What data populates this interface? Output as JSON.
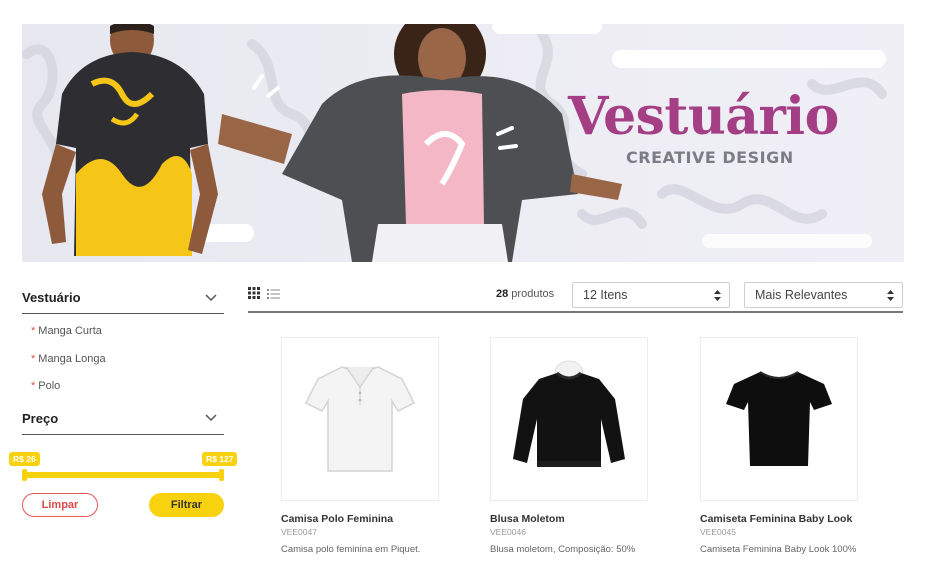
{
  "banner": {
    "title": "Vestuário",
    "subtitle": "CREATIVE DESIGN",
    "accent_color": "#a43f86"
  },
  "sidebar": {
    "category_filter": {
      "title": "Vestuário",
      "items": [
        {
          "label": "Manga Curta"
        },
        {
          "label": "Manga Longa"
        },
        {
          "label": "Polo"
        }
      ]
    },
    "price_filter": {
      "title": "Preço",
      "min_label": "R$ 26",
      "max_label": "R$ 127",
      "clear_label": "Limpar",
      "apply_label": "Filtrar"
    }
  },
  "toolbar": {
    "count_number": "28",
    "count_suffix": " produtos",
    "per_page_value": "12 Itens",
    "sort_value": "Mais Relevantes",
    "view_grid_icon": "grid-view-icon",
    "view_list_icon": "list-view-icon"
  },
  "products": [
    {
      "name": "Camisa Polo Feminina",
      "sku": "VEE0047",
      "desc": "Camisa polo feminina em Piquet."
    },
    {
      "name": "Blusa Moletom",
      "sku": "VEE0046",
      "desc": "Blusa moletom, Composição: 50%"
    },
    {
      "name": "Camiseta Feminina Baby Look",
      "sku": "VEE0045",
      "desc": "Camiseta Feminina Baby Look 100%"
    }
  ],
  "colors": {
    "yellow": "#f8d20e",
    "danger": "#e85858"
  }
}
